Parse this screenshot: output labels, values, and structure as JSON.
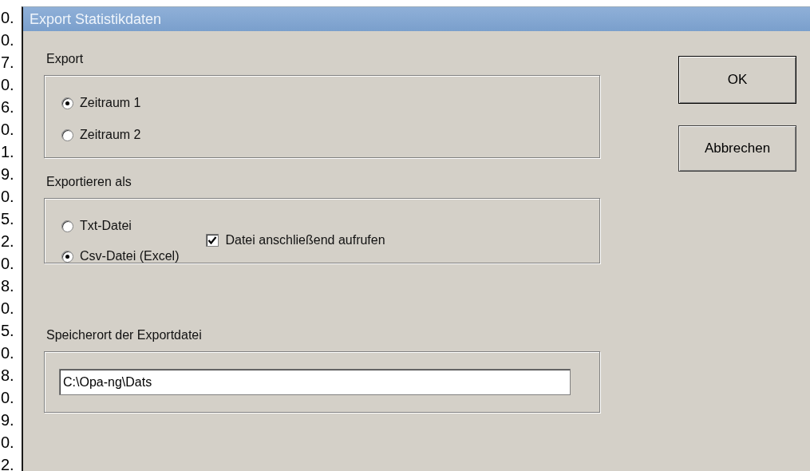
{
  "background_column": [
    "0.",
    "0.",
    "7.",
    "0.",
    "6.",
    "0.",
    "1.",
    "9.",
    "0.",
    "5.",
    "2.",
    "0.",
    "8.",
    "0.",
    "5.",
    "0.",
    "8.",
    "0.",
    "9.",
    "0.",
    "2."
  ],
  "window": {
    "title": "Export Statistikdaten"
  },
  "export_group": {
    "label": "Export",
    "options": [
      {
        "label": "Zeitraum 1",
        "selected": true
      },
      {
        "label": "Zeitraum 2",
        "selected": false
      }
    ]
  },
  "format_group": {
    "label": "Exportieren als",
    "options": [
      {
        "label": "Txt-Datei",
        "selected": false
      },
      {
        "label": "Csv-Datei (Excel)",
        "selected": true
      }
    ],
    "open_after": {
      "label": "Datei anschließend aufrufen",
      "checked": true
    }
  },
  "location_group": {
    "label": "Speicherort der Exportdatei",
    "path": "C:\\Opa-ng\\Dats"
  },
  "buttons": [
    {
      "label": "OK"
    },
    {
      "label": "Abbrechen"
    }
  ]
}
